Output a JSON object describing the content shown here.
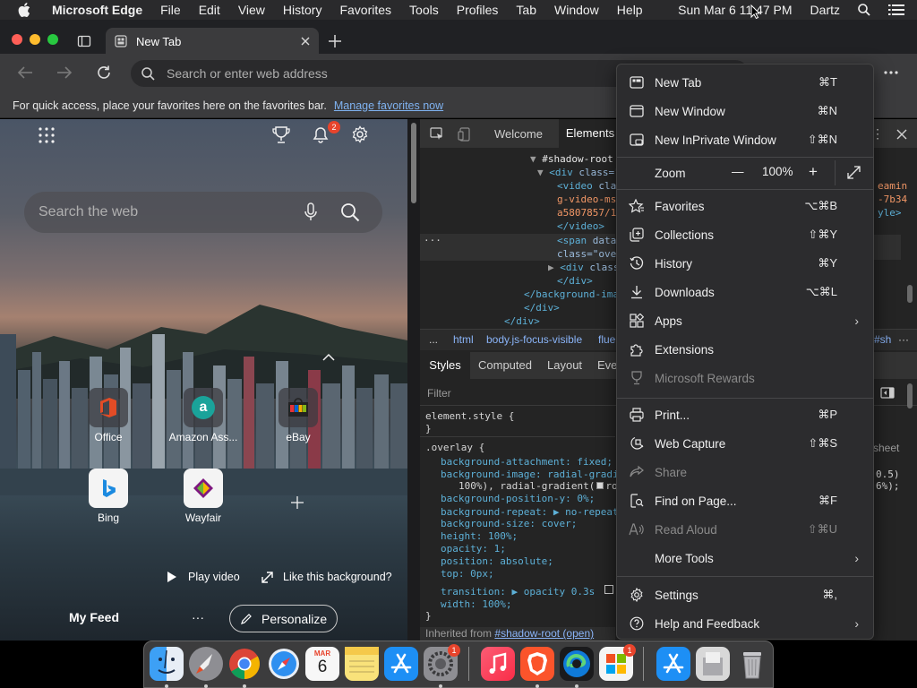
{
  "menubar": {
    "app_name": "Microsoft Edge",
    "items": [
      "File",
      "Edit",
      "View",
      "History",
      "Favorites",
      "Tools",
      "Profiles",
      "Tab",
      "Window",
      "Help"
    ],
    "datetime": "Sun Mar 6 11:47 PM",
    "user": "Dartz"
  },
  "browser": {
    "tab_title": "New Tab",
    "address_placeholder": "Search or enter web address",
    "favbar_text": "For quick access, place your favorites here on the favorites bar.",
    "favbar_link": "Manage favorites now"
  },
  "ntp": {
    "notification_count": "2",
    "search_placeholder": "Search the web",
    "tiles": [
      "Office",
      "Amazon Ass...",
      "eBay",
      "Bing",
      "Wayfair"
    ],
    "play_video": "Play video",
    "like_background": "Like this background?",
    "my_feed": "My Feed",
    "more": "···",
    "personalize": "Personalize"
  },
  "devtools": {
    "tabs": [
      "Welcome",
      "Elements"
    ],
    "dom_lines": {
      "l0": "#shadow-root",
      "l1_tag": "<div",
      "l1_attr": "class=\"",
      "l2_tag": "<video",
      "l2_attr": "cla",
      "l3": "g-video-ms",
      "l4": "a5807857/1",
      "l5": "</video>",
      "l6_tag": "<span",
      "l6_attr": "data",
      "l7": "class=\"ove",
      "l8_tag": "<div",
      "l8_attr": "class",
      "l9": "</div>",
      "l10": "</background-ima",
      "l11": "</div>",
      "l12": "</div>",
      "r1": "eamin",
      "r2": "-7b34",
      "r3": "yle>",
      "more": "···"
    },
    "breadcrumbs": [
      "...",
      "html",
      "body.js-focus-visible",
      "flue",
      "#sh",
      "···"
    ],
    "style_tabs": [
      "Styles",
      "Computed",
      "Layout",
      "Eve"
    ],
    "filter_placeholder": "Filter",
    "css": {
      "element_style": "element.style {",
      "close1": "}",
      "overlay": ".overlay {",
      "p1": "background-attachment: fixed;",
      "p2": "background-image: radial-gradi",
      "p2b": "100%), radial-gradient(",
      "p2c": "ro",
      "p3": "background-position-y: 0%;",
      "p4": "background-repeat: ▶ no-repeat",
      "p5": "background-size: cover;",
      "p6": "height: 100%;",
      "p7": "opacity: 1;",
      "p8": "position: absolute;",
      "p9": "top: 0px;",
      "p10": "transition: ▶ opacity 0.3s",
      "p11": "width: 100%;",
      "close2": "}",
      "inherited": "Inherited from",
      "inherited_link": "#shadow-root (open)",
      "r1": "sheet",
      "r2": "0.5)",
      "r3": "6%);"
    }
  },
  "menu": {
    "new_tab": {
      "label": "New Tab",
      "shortcut": "⌘T"
    },
    "new_window": {
      "label": "New Window",
      "shortcut": "⌘N"
    },
    "inprivate": {
      "label": "New InPrivate Window",
      "shortcut": "⇧⌘N"
    },
    "zoom": {
      "label": "Zoom",
      "minus": "—",
      "value": "100%",
      "plus": "+"
    },
    "favorites": {
      "label": "Favorites",
      "shortcut": "⌥⌘B"
    },
    "collections": {
      "label": "Collections",
      "shortcut": "⇧⌘Y"
    },
    "history": {
      "label": "History",
      "shortcut": "⌘Y"
    },
    "downloads": {
      "label": "Downloads",
      "shortcut": "⌥⌘L"
    },
    "apps": {
      "label": "Apps"
    },
    "extensions": {
      "label": "Extensions"
    },
    "rewards": {
      "label": "Microsoft Rewards"
    },
    "print": {
      "label": "Print...",
      "shortcut": "⌘P"
    },
    "web_capture": {
      "label": "Web Capture",
      "shortcut": "⇧⌘S"
    },
    "share": {
      "label": "Share"
    },
    "find": {
      "label": "Find on Page...",
      "shortcut": "⌘F"
    },
    "read_aloud": {
      "label": "Read Aloud",
      "shortcut": "⇧⌘U"
    },
    "more_tools": {
      "label": "More Tools"
    },
    "settings": {
      "label": "Settings",
      "shortcut": "⌘,"
    },
    "help": {
      "label": "Help and Feedback"
    }
  },
  "dock": {
    "calendar_month": "MAR",
    "calendar_day": "6",
    "settings_badge": "1",
    "store_badge": "1"
  },
  "colors": {
    "accent_link": "#7fb2f0",
    "badge": "#e8442c"
  }
}
